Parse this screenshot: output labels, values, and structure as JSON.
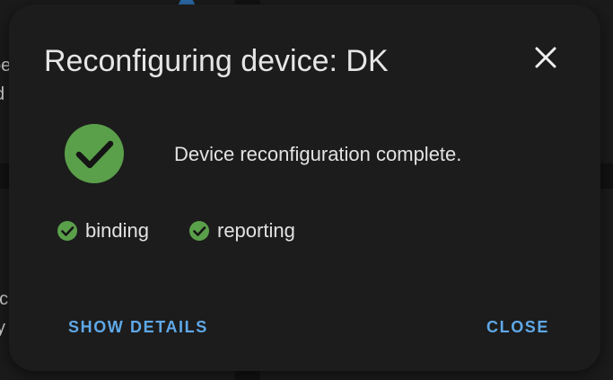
{
  "dialog": {
    "title": "Reconfiguring device: DK",
    "status_message": "Device reconfiguration complete.",
    "steps": [
      {
        "label": "binding",
        "icon": "check-circle-icon"
      },
      {
        "label": "reporting",
        "icon": "check-circle-icon"
      }
    ],
    "actions": {
      "show_details_label": "SHOW DETAILS",
      "close_label": "CLOSE"
    },
    "close_icon": "close-icon",
    "status_icon": "check-circle-icon"
  },
  "background": {
    "fragments": [
      "oe",
      "d",
      "nc",
      "y"
    ]
  },
  "colors": {
    "success_green": "#5aa04a",
    "accent_blue": "#5fa8e8",
    "dialog_bg": "#1c1c1c",
    "text": "#e2e2e2"
  }
}
